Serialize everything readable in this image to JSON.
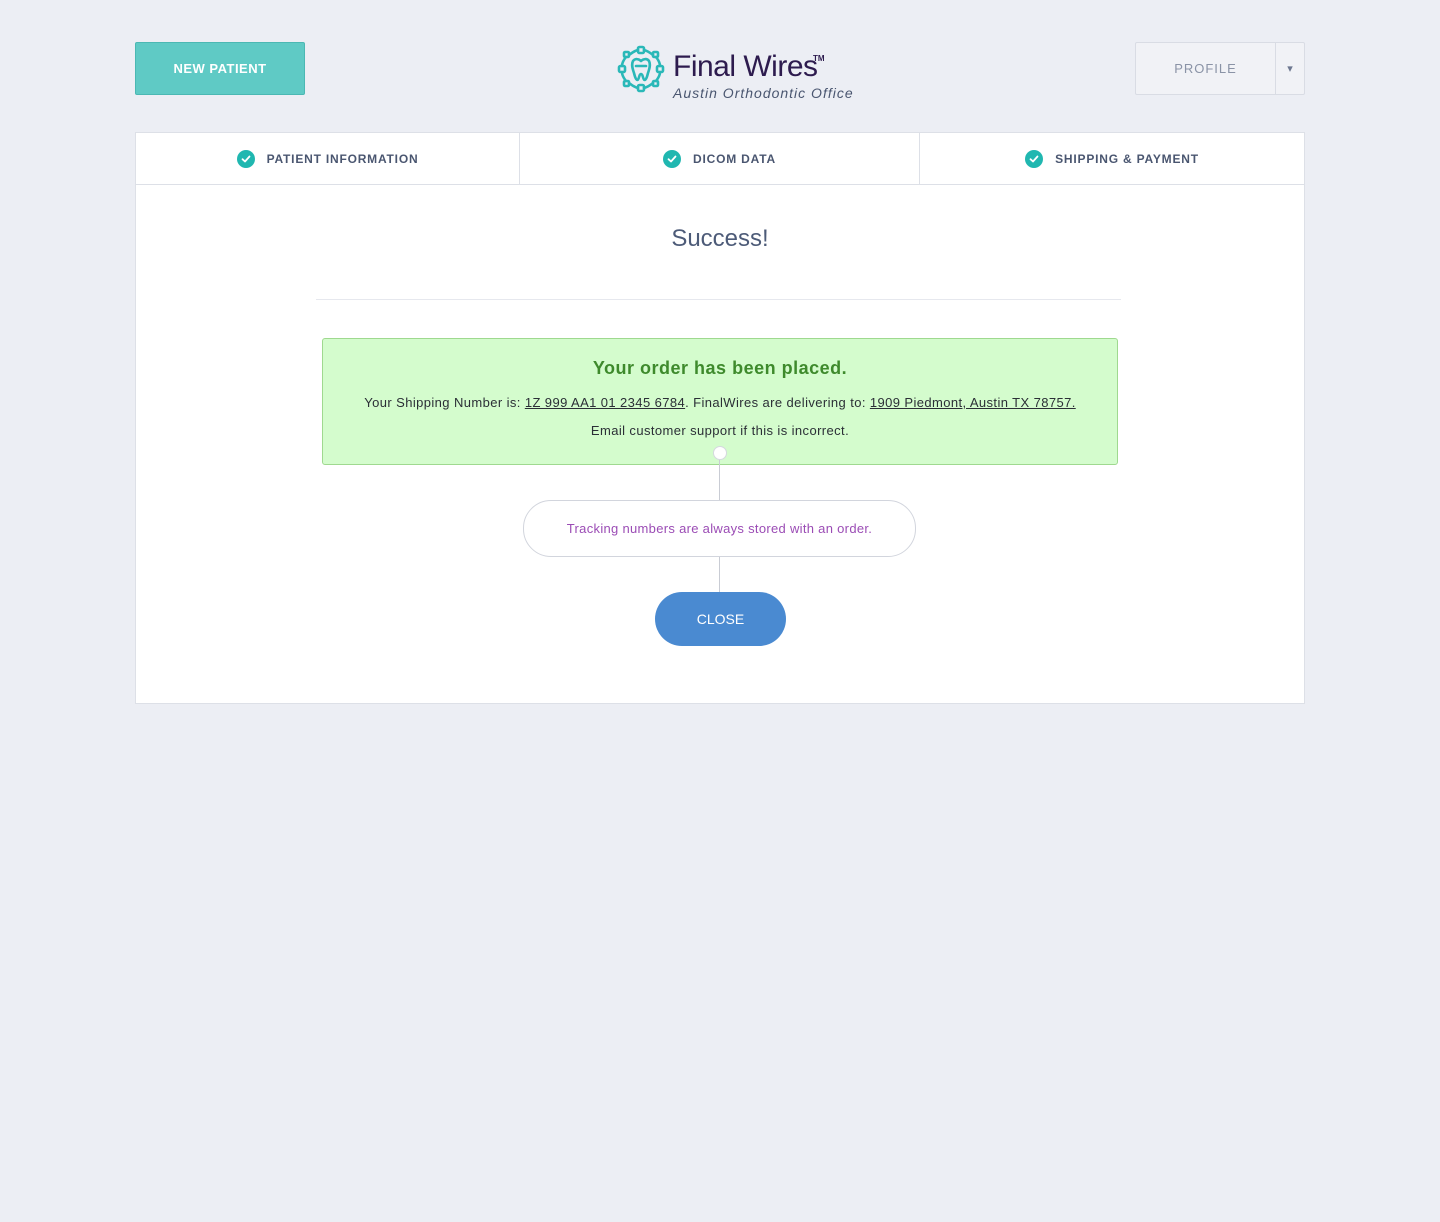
{
  "header": {
    "new_patient_label": "NEW PATIENT",
    "logo_name": "Final Wires",
    "logo_tm": "TM",
    "logo_subtitle": "Austin Orthodontic Office",
    "profile_label": "PROFILE",
    "profile_caret": "▾"
  },
  "steps": [
    {
      "label": "PATIENT INFORMATION",
      "icon": "check-circle-icon",
      "complete": true
    },
    {
      "label": "DICOM DATA",
      "icon": "check-circle-icon",
      "complete": true
    },
    {
      "label": "SHIPPING & PAYMENT",
      "icon": "check-circle-icon",
      "complete": true
    }
  ],
  "main": {
    "title": "Success!",
    "alert": {
      "heading": "Your order has been placed.",
      "shipping_prefix": "Your Shipping Number is: ",
      "shipping_number": "1Z 999 AA1 01 2345 6784",
      "delivering_prefix": ". FinalWires are delivering to: ",
      "address": "1909 Piedmont, Austin TX 78757.",
      "support_text": "Email customer support if this is incorrect."
    },
    "note": "Tracking numbers are always stored with an order.",
    "close_label": "CLOSE"
  },
  "colors": {
    "background": "#eceef4",
    "accent_teal": "#5fcac5",
    "check_teal": "#20b7b0",
    "success_bg": "#d4fccd",
    "success_text": "#3e8a2c",
    "note_text": "#9b4cb5",
    "close_button": "#4a8ad1",
    "logo_text": "#2d1b4e"
  }
}
